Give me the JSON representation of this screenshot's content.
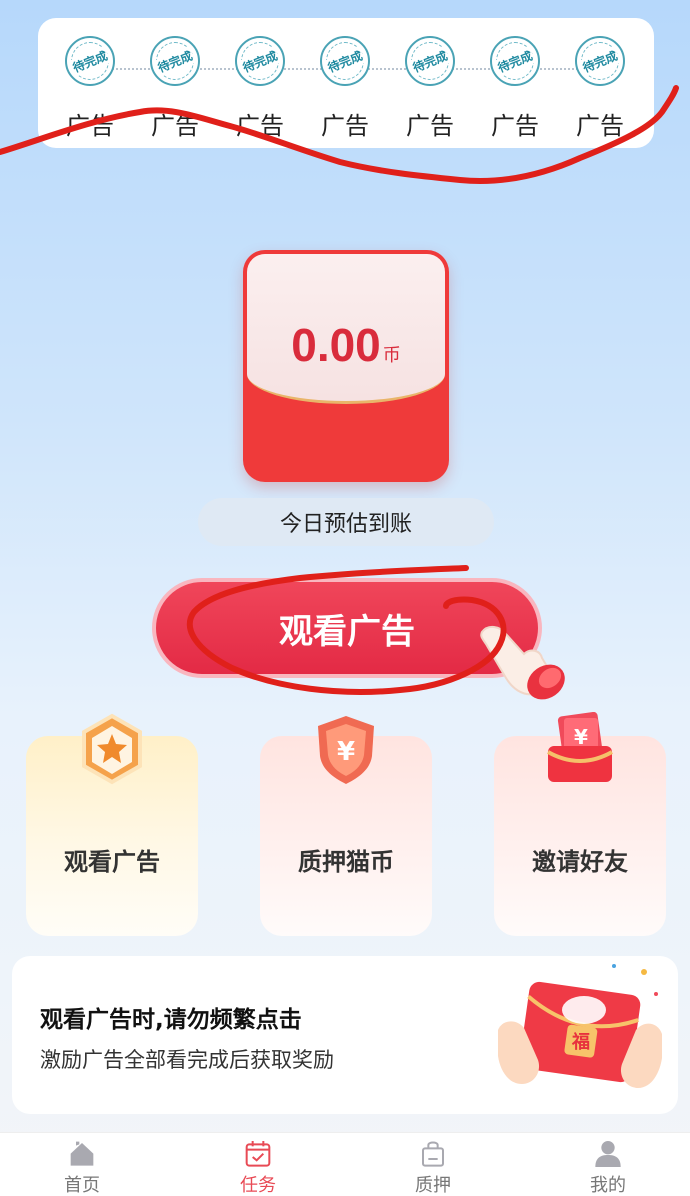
{
  "progress": {
    "items": [
      {
        "label": "广告",
        "stamp": "待完成"
      },
      {
        "label": "广告",
        "stamp": "待完成"
      },
      {
        "label": "广告",
        "stamp": "待完成"
      },
      {
        "label": "广告",
        "stamp": "待完成"
      },
      {
        "label": "广告",
        "stamp": "待完成"
      },
      {
        "label": "广告",
        "stamp": "待完成"
      },
      {
        "label": "广告",
        "stamp": "待完成"
      }
    ]
  },
  "envelope": {
    "amount": "0.00",
    "unit": "币"
  },
  "today_label": "今日预估到账",
  "watch_button": "观看广告",
  "features": [
    {
      "label": "观看广告",
      "icon": "star-badge-icon"
    },
    {
      "label": "质押猫币",
      "icon": "yen-shield-icon"
    },
    {
      "label": "邀请好友",
      "icon": "red-envelope-icon"
    }
  ],
  "notice": {
    "title": "观看广告时,请勿频繁点击",
    "subtitle": "激励广告全部看完成后获取奖励"
  },
  "tabs": [
    {
      "label": "首页",
      "icon": "home-icon",
      "active": false
    },
    {
      "label": "任务",
      "icon": "calendar-check-icon",
      "active": true
    },
    {
      "label": "质押",
      "icon": "bag-icon",
      "active": false
    },
    {
      "label": "我的",
      "icon": "user-icon",
      "active": false
    }
  ],
  "colors": {
    "accent": "#e32a45",
    "stamp": "#4aa3b5",
    "tab_active": "#e84a55"
  }
}
